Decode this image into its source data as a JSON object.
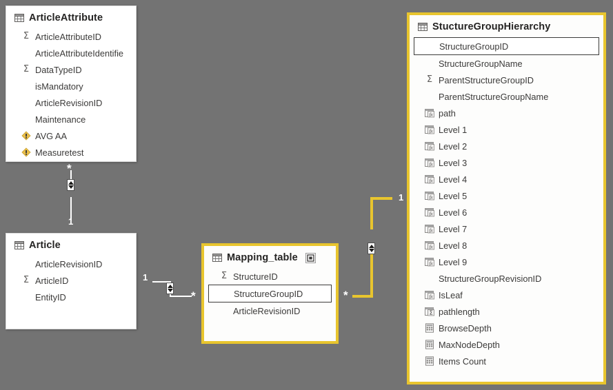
{
  "canvas": {
    "background": "#737373",
    "accent_gold": "#e8c52e",
    "line_color": "#ffffff",
    "card_background": "#ffffff"
  },
  "tables": [
    {
      "name": "ArticleAttribute",
      "icon": "table-icon",
      "selected": false,
      "fields": [
        {
          "label": "ArticleAttributeID",
          "icon": "sigma-icon",
          "highlight": false
        },
        {
          "label": "ArticleAttributeIdentifie",
          "icon": "none",
          "highlight": false
        },
        {
          "label": "DataTypeID",
          "icon": "sigma-icon",
          "highlight": false
        },
        {
          "label": "isMandatory",
          "icon": "none",
          "highlight": false
        },
        {
          "label": "ArticleRevisionID",
          "icon": "none",
          "highlight": false
        },
        {
          "label": "Maintenance",
          "icon": "none",
          "highlight": false
        },
        {
          "label": "AVG AA",
          "icon": "measure-icon",
          "highlight": false
        },
        {
          "label": "Measuretest",
          "icon": "measure-icon",
          "highlight": false
        }
      ]
    },
    {
      "name": "Article",
      "icon": "table-icon",
      "selected": false,
      "fields": [
        {
          "label": "ArticleRevisionID",
          "icon": "none",
          "highlight": false
        },
        {
          "label": "ArticleID",
          "icon": "sigma-icon",
          "highlight": false
        },
        {
          "label": "EntityID",
          "icon": "none",
          "highlight": false
        }
      ]
    },
    {
      "name": "Mapping_table",
      "icon": "table-icon",
      "badge_icon": "nested-square-icon",
      "selected": true,
      "fields": [
        {
          "label": "StructureID",
          "icon": "sigma-icon",
          "highlight": false
        },
        {
          "label": "StructureGroupID",
          "icon": "none",
          "highlight": true
        },
        {
          "label": "ArticleRevisionID",
          "icon": "none",
          "highlight": false
        }
      ]
    },
    {
      "name": "StuctureGroupHierarchy",
      "icon": "table-icon",
      "selected": true,
      "fields": [
        {
          "label": "StructureGroupID",
          "icon": "none",
          "highlight": true
        },
        {
          "label": "StructureGroupName",
          "icon": "none",
          "highlight": false
        },
        {
          "label": "ParentStructureGroupID",
          "icon": "sigma-icon",
          "highlight": false
        },
        {
          "label": "ParentStructureGroupName",
          "icon": "none",
          "highlight": false
        },
        {
          "label": "path",
          "icon": "calc-column-icon",
          "highlight": false
        },
        {
          "label": "Level 1",
          "icon": "calc-column-icon",
          "highlight": false
        },
        {
          "label": "Level 2",
          "icon": "calc-column-icon",
          "highlight": false
        },
        {
          "label": "Level 3",
          "icon": "calc-column-icon",
          "highlight": false
        },
        {
          "label": "Level 4",
          "icon": "calc-column-icon",
          "highlight": false
        },
        {
          "label": "Level 5",
          "icon": "calc-column-icon",
          "highlight": false
        },
        {
          "label": "Level 6",
          "icon": "calc-column-icon",
          "highlight": false
        },
        {
          "label": "Level 7",
          "icon": "calc-column-icon",
          "highlight": false
        },
        {
          "label": "Level 8",
          "icon": "calc-column-icon",
          "highlight": false
        },
        {
          "label": "Level 9",
          "icon": "calc-column-icon",
          "highlight": false
        },
        {
          "label": "StructureGroupRevisionID",
          "icon": "none",
          "highlight": false
        },
        {
          "label": "IsLeaf",
          "icon": "calc-column-icon",
          "highlight": false
        },
        {
          "label": "pathlength",
          "icon": "calc-sigma-icon",
          "highlight": false
        },
        {
          "label": "BrowseDepth",
          "icon": "hierarchy-icon",
          "highlight": false
        },
        {
          "label": "MaxNodeDepth",
          "icon": "hierarchy-icon",
          "highlight": false
        },
        {
          "label": "Items Count",
          "icon": "hierarchy-icon",
          "highlight": false
        }
      ]
    }
  ],
  "relationships": [
    {
      "id": "articleattribute-article",
      "from_cardinality": "*",
      "to_cardinality": "1",
      "cross_filter": "both",
      "highlighted": false
    },
    {
      "id": "article-mapping_table",
      "from_cardinality": "1",
      "to_cardinality": "*",
      "cross_filter": "both",
      "highlighted": false
    },
    {
      "id": "mapping_table-stucturegrouphierarchy",
      "from_cardinality": "*",
      "to_cardinality": "1",
      "cross_filter": "both",
      "highlighted": true
    }
  ]
}
